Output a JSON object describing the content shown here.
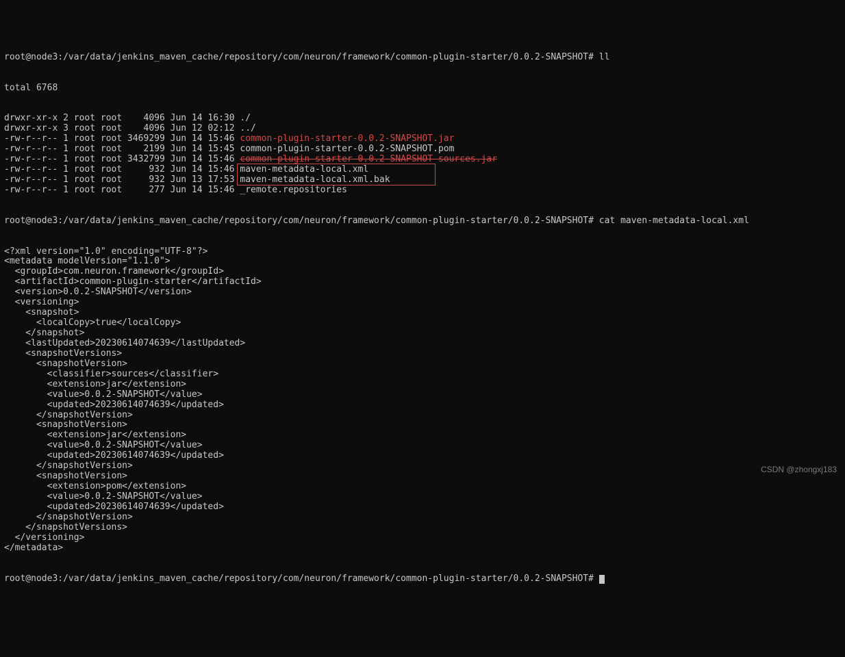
{
  "prompt_path": "root@node3:/var/data/jenkins_maven_cache/repository/com/neuron/framework/common-plugin-starter/0.0.2-SNAPSHOT#",
  "cmd_ll": "ll",
  "cmd_cat": "cat maven-metadata-local.xml",
  "total_line": "total 6768",
  "ls": [
    {
      "perm": "drwxr-xr-x",
      "links": "2",
      "user": "root",
      "group": "root",
      "size": "4096",
      "date": "Jun 14 16:30",
      "name": "./",
      "cls": ""
    },
    {
      "perm": "drwxr-xr-x",
      "links": "3",
      "user": "root",
      "group": "root",
      "size": "4096",
      "date": "Jun 12 02:12",
      "name": "../",
      "cls": ""
    },
    {
      "perm": "-rw-r--r--",
      "links": "1",
      "user": "root",
      "group": "root",
      "size": "3469299",
      "date": "Jun 14 15:46",
      "name": "common-plugin-starter-0.0.2-SNAPSHOT.jar",
      "cls": "red"
    },
    {
      "perm": "-rw-r--r--",
      "links": "1",
      "user": "root",
      "group": "root",
      "size": "2199",
      "date": "Jun 14 15:45",
      "name": "common-plugin-starter-0.0.2-SNAPSHOT.pom",
      "cls": ""
    },
    {
      "perm": "-rw-r--r--",
      "links": "1",
      "user": "root",
      "group": "root",
      "size": "3432799",
      "date": "Jun 14 15:46",
      "name": "common-plugin-starter-0.0.2-SNAPSHOT-sources.jar",
      "cls": "red strike"
    },
    {
      "perm": "-rw-r--r--",
      "links": "1",
      "user": "root",
      "group": "root",
      "size": "932",
      "date": "Jun 14 15:46",
      "name": "maven-metadata-local.xml",
      "cls": "boxed"
    },
    {
      "perm": "-rw-r--r--",
      "links": "1",
      "user": "root",
      "group": "root",
      "size": "932",
      "date": "Jun 13 17:53",
      "name": "maven-metadata-local.xml.bak",
      "cls": "boxed"
    },
    {
      "perm": "-rw-r--r--",
      "links": "1",
      "user": "root",
      "group": "root",
      "size": "277",
      "date": "Jun 14 15:46",
      "name": "_remote.repositories",
      "cls": ""
    }
  ],
  "xml": [
    "<?xml version=\"1.0\" encoding=\"UTF-8\"?>",
    "<metadata modelVersion=\"1.1.0\">",
    "  <groupId>com.neuron.framework</groupId>",
    "  <artifactId>common-plugin-starter</artifactId>",
    "  <version>0.0.2-SNAPSHOT</version>",
    "  <versioning>",
    "    <snapshot>",
    "      <localCopy>true</localCopy>",
    "    </snapshot>",
    "    <lastUpdated>20230614074639</lastUpdated>",
    "    <snapshotVersions>",
    "      <snapshotVersion>",
    "        <classifier>sources</classifier>",
    "        <extension>jar</extension>",
    "        <value>0.0.2-SNAPSHOT</value>",
    "        <updated>20230614074639</updated>",
    "      </snapshotVersion>",
    "      <snapshotVersion>",
    "        <extension>jar</extension>",
    "        <value>0.0.2-SNAPSHOT</value>",
    "        <updated>20230614074639</updated>",
    "      </snapshotVersion>",
    "      <snapshotVersion>",
    "        <extension>pom</extension>",
    "        <value>0.0.2-SNAPSHOT</value>",
    "        <updated>20230614074639</updated>",
    "      </snapshotVersion>",
    "    </snapshotVersions>",
    "  </versioning>",
    "</metadata>"
  ],
  "watermark": "CSDN @zhongxj183"
}
